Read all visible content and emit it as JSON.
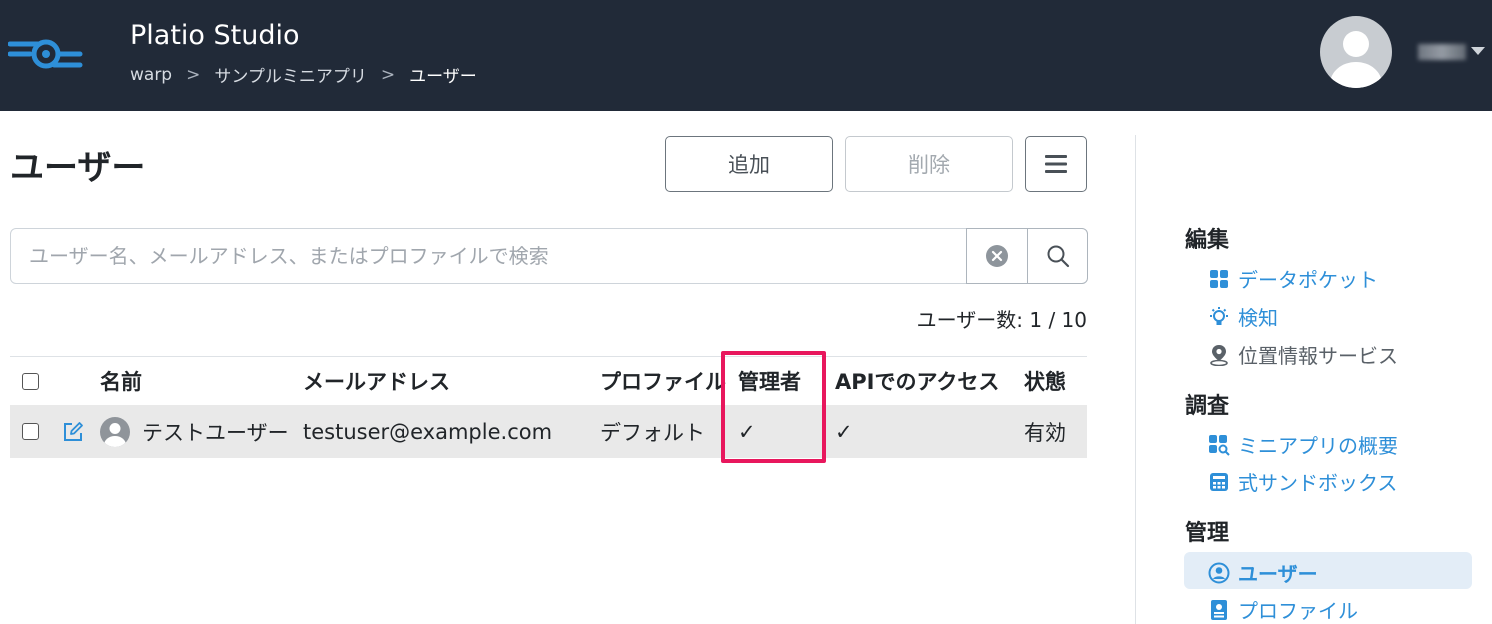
{
  "header": {
    "app_title": "Platio Studio",
    "breadcrumb": [
      "warp",
      "サンプルミニアプリ",
      "ユーザー"
    ],
    "breadcrumb_sep": ">"
  },
  "page": {
    "title": "ユーザー",
    "buttons": {
      "add": "追加",
      "delete": "削除"
    }
  },
  "search": {
    "placeholder": "ユーザー名、メールアドレス、またはプロファイルで検索",
    "value": ""
  },
  "user_count": "ユーザー数: 1 / 10",
  "table": {
    "headers": [
      "名前",
      "メールアドレス",
      "プロファイル",
      "管理者",
      "APIでのアクセス",
      "状態"
    ],
    "rows": [
      {
        "name": "テストユーザー",
        "email": "testuser@example.com",
        "profile": "デフォルト",
        "admin": "✓",
        "api": "✓",
        "status": "有効"
      }
    ]
  },
  "sidebar": {
    "sections": [
      {
        "title": "編集",
        "items": [
          "データポケット",
          "検知",
          "位置情報サービス"
        ]
      },
      {
        "title": "調査",
        "items": [
          "ミニアプリの概要",
          "式サンドボックス"
        ]
      },
      {
        "title": "管理",
        "items": [
          "ユーザー",
          "プロファイル"
        ]
      }
    ]
  },
  "colors": {
    "header_bg": "#212a38",
    "accent": "#2e8fd8",
    "highlight": "#e8175d"
  }
}
